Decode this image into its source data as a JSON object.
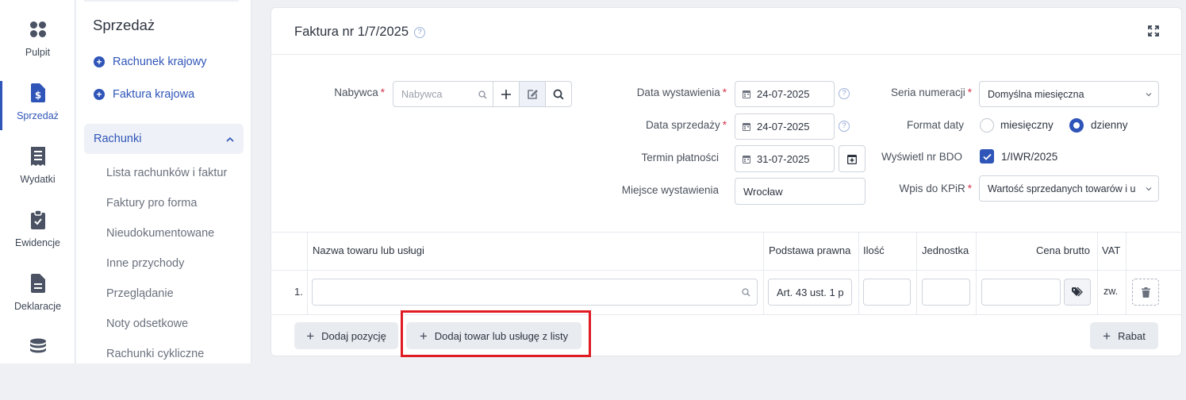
{
  "rail": [
    {
      "label": "Pulpit",
      "icon": "grid-icon"
    },
    {
      "label": "Sprzedaż",
      "icon": "dollar-document-icon"
    },
    {
      "label": "Wydatki",
      "icon": "receipt-icon"
    },
    {
      "label": "Ewidencje",
      "icon": "clipboard-icon"
    },
    {
      "label": "Deklaracje",
      "icon": "document-icon"
    },
    {
      "label": "",
      "icon": "coins-icon"
    }
  ],
  "submenu": {
    "title": "Sprzedaż",
    "quick": [
      "Rachunek krajowy",
      "Faktura krajowa"
    ],
    "group": "Rachunki",
    "links": [
      "Lista rachunków i faktur",
      "Faktury pro forma",
      "Nieudokumentowane",
      "Inne przychody",
      "Przeglądanie",
      "Noty odsetkowe",
      "Rachunki cykliczne"
    ]
  },
  "card": {
    "title": "Faktura nr 1/7/2025",
    "help": "?"
  },
  "form": {
    "buyer_label": "Nabywca",
    "buyer_placeholder": "Nabywca",
    "issue_date_label": "Data wystawienia",
    "issue_date": "24-07-2025",
    "sale_date_label": "Data sprzedaży",
    "sale_date": "24-07-2025",
    "due_date_label": "Termin płatności",
    "due_date": "31-07-2025",
    "place_label": "Miejsce wystawienia",
    "place": "Wrocław",
    "series_label": "Seria numeracji",
    "series": "Domyślna miesięczna",
    "date_format_label": "Format daty",
    "date_format_options": [
      "miesięczny",
      "dzienny"
    ],
    "date_format_selected": "dzienny",
    "bdo_label": "Wyświetl nr BDO",
    "bdo_value": "1/IWR/2025",
    "kpir_label": "Wpis do KPiR",
    "kpir": "Wartość sprzedanych towarów i u"
  },
  "table": {
    "headers": [
      "Nazwa towaru lub usługi",
      "Podstawa prawna",
      "Ilość",
      "Jednostka",
      "Cena brutto",
      "VAT"
    ],
    "rows": [
      {
        "no": "1.",
        "name": "",
        "basis": "Art. 43 ust. 1 p",
        "qty": "",
        "unit": "",
        "price": "",
        "vat": "zw."
      }
    ]
  },
  "buttons": {
    "add_position": "Dodaj pozycję",
    "add_from_list": "Dodaj towar lub usługę z listy",
    "discount": "Rabat"
  },
  "colors": {
    "accent": "#2f55b8",
    "required": "#d6334a",
    "highlight": "#e01b24"
  }
}
